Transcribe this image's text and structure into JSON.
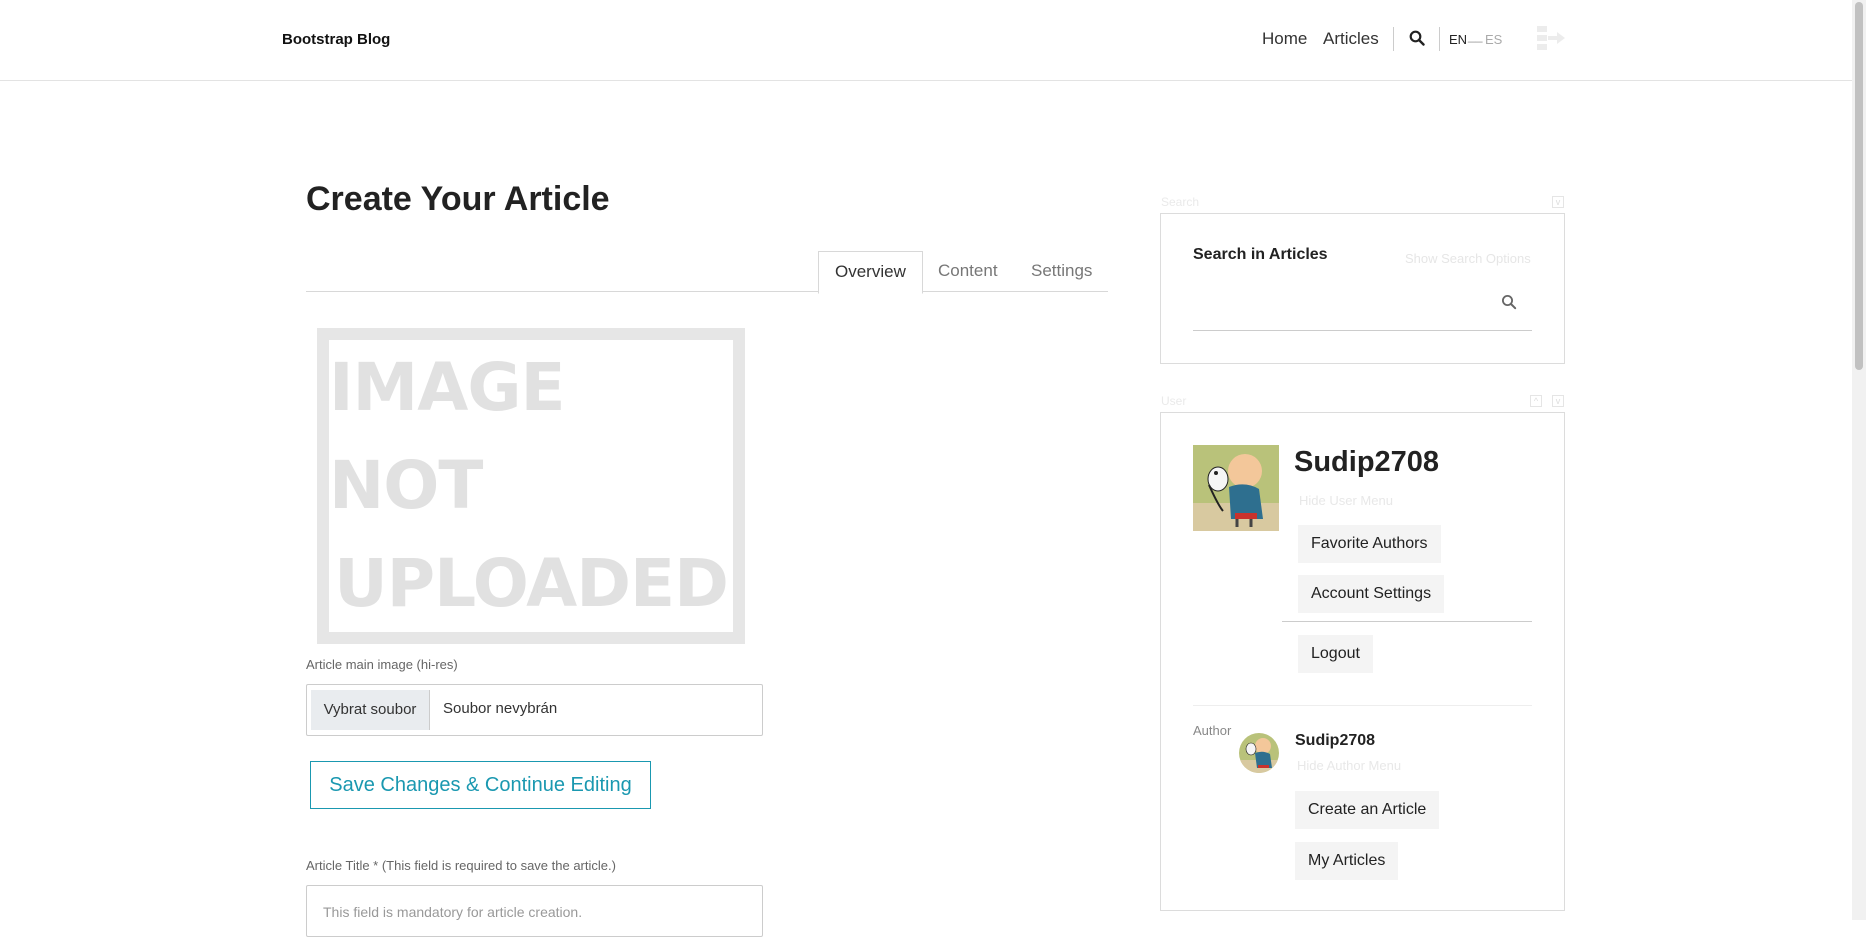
{
  "navbar": {
    "brand": "Bootstrap Blog",
    "links": [
      "Home",
      "Articles"
    ],
    "search_icon": "search-icon",
    "languages": {
      "en": "EN",
      "separator": "__",
      "es": "ES"
    },
    "login_icon": "sign-in-icon"
  },
  "main": {
    "title": "Create Your Article",
    "tabs": [
      {
        "label": "Overview",
        "active": true
      },
      {
        "label": "Content",
        "active": false
      },
      {
        "label": "Settings",
        "active": false
      }
    ],
    "image_placeholder": {
      "line1": "IMAGE NOT",
      "line2": "UPLOADED"
    },
    "image_label": "Article main image (hi-res)",
    "file_button": "Vybrat soubor",
    "file_status": "Soubor nevybrán",
    "save_button": "Save Changes & Continue Editing",
    "title_label": "Article Title * (This field is required to save the article.)",
    "title_placeholder": "This field is mandatory for article creation."
  },
  "sidebar": {
    "search_portlet": {
      "portlet_title": "Search",
      "heading": "Search in Articles",
      "options_toggle": "Show Search Options",
      "search_icon": "search-icon"
    },
    "user_portlet": {
      "portlet_title": "User",
      "username": "Sudip2708",
      "hide_user_menu": "Hide User Menu",
      "user_menu": [
        "Favorite Authors",
        "Account Settings"
      ],
      "logout": "Logout",
      "author_label": "Author",
      "author_name": "Sudip2708",
      "hide_author_menu": "Hide Author Menu",
      "author_menu": [
        "Create an Article",
        "My Articles"
      ]
    }
  },
  "colors": {
    "accent": "#1a98b0",
    "placeholder_gray": "#e1e1e1",
    "border": "#dcdcdc"
  }
}
